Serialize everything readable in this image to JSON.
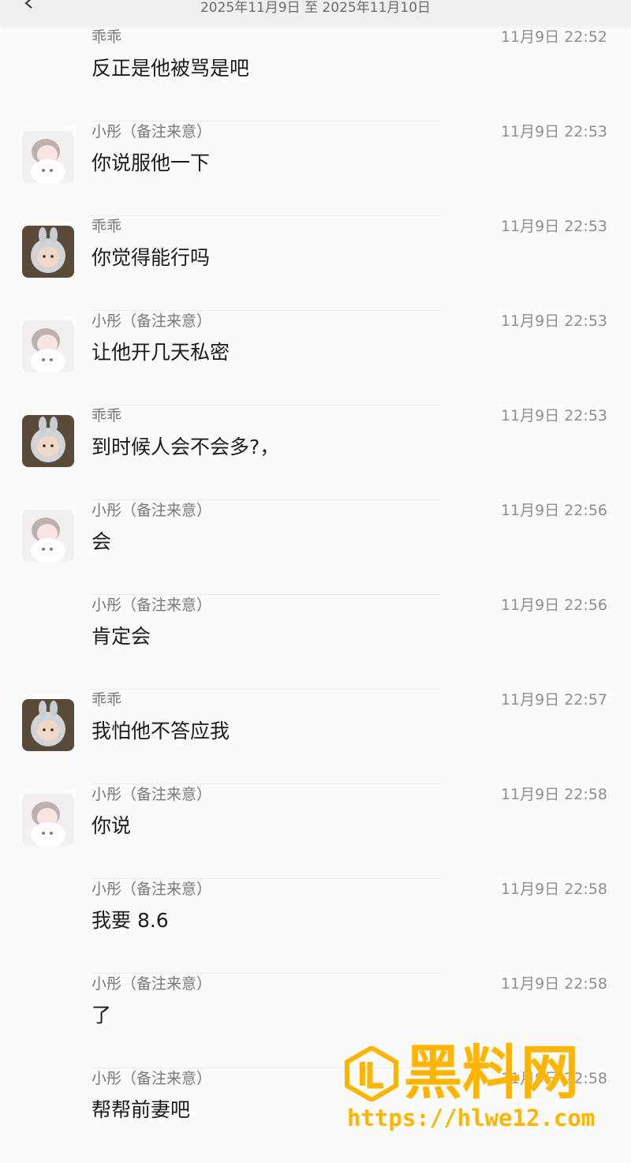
{
  "header": {
    "range_title": "2025年11月9日 至 2025年11月10日"
  },
  "contacts": {
    "guaiguai": "乖乖",
    "xiaotong": "小彤（备注来意）"
  },
  "messages": [
    {
      "sender": "乖乖",
      "time": "11月9日 22:52",
      "text": "反正是他被骂是吧",
      "avatar": "none"
    },
    {
      "sender": "小彤（备注来意）",
      "time": "11月9日 22:53",
      "text": "你说服他一下",
      "avatar": "girl"
    },
    {
      "sender": "乖乖",
      "time": "11月9日 22:53",
      "text": "你觉得能行吗",
      "avatar": "doll"
    },
    {
      "sender": "小彤（备注来意）",
      "time": "11月9日 22:53",
      "text": "让他开几天私密",
      "avatar": "girl"
    },
    {
      "sender": "乖乖",
      "time": "11月9日 22:53",
      "text": "到时候人会不会多?，",
      "avatar": "doll"
    },
    {
      "sender": "小彤（备注来意）",
      "time": "11月9日 22:56",
      "text": "会",
      "avatar": "girl"
    },
    {
      "sender": "小彤（备注来意）",
      "time": "11月9日 22:56",
      "text": "肯定会",
      "avatar": "none"
    },
    {
      "sender": "乖乖",
      "time": "11月9日 22:57",
      "text": "我怕他不答应我",
      "avatar": "doll"
    },
    {
      "sender": "小彤（备注来意）",
      "time": "11月9日 22:58",
      "text": "你说",
      "avatar": "girl"
    },
    {
      "sender": "小彤（备注来意）",
      "time": "11月9日 22:58",
      "text": "我要 8.6",
      "avatar": "none"
    },
    {
      "sender": "小彤（备注来意）",
      "time": "11月9日 22:58",
      "text": "了",
      "avatar": "none"
    },
    {
      "sender": "小彤（备注来意）",
      "time": "11月9日 22:58",
      "text": "帮帮前妻吧",
      "avatar": "none"
    }
  ],
  "watermark": {
    "title": "黑料网",
    "url": "https://hlwe12.com",
    "color": "#ffb400"
  }
}
